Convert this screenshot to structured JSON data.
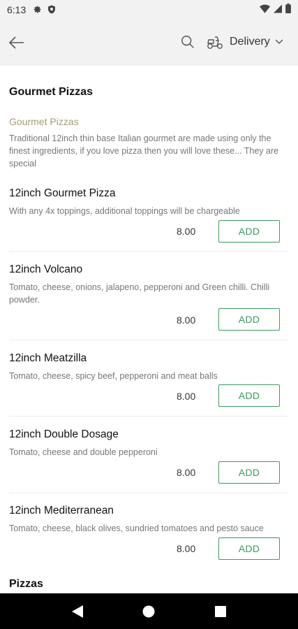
{
  "status_bar": {
    "time": "6:13",
    "icons": [
      "gear-icon",
      "shield-icon",
      "wifi-icon",
      "signal-icon",
      "battery-icon"
    ]
  },
  "header": {
    "back_icon": "arrow-left-icon",
    "search_icon": "search-icon",
    "delivery_icon": "scooter-icon",
    "delivery_label": "Delivery",
    "dropdown_icon": "chevron-down-icon"
  },
  "section": {
    "title": "Gourmet Pizzas",
    "sub_heading": "Gourmet Pizzas",
    "description": "Traditional 12inch thin base Italian gourmet are made using only the finest ingredients, if you love pizza then you will love these... They are special"
  },
  "items": [
    {
      "name": "12inch Gourmet Pizza",
      "description": "With any 4x toppings, additional toppings will be chargeable",
      "price": "8.00",
      "button": "ADD"
    },
    {
      "name": "12inch Volcano",
      "description": "Tomato, cheese, onions, jalapeno, pepperoni and Green chilli. Chilli powder.",
      "price": "8.00",
      "button": "ADD"
    },
    {
      "name": "12inch Meatzilla",
      "description": "Tomato, cheese, spicy beef, pepperoni and meat balls",
      "price": "8.00",
      "button": "ADD"
    },
    {
      "name": "12inch Double Dosage",
      "description": "Tomato, cheese and double pepperoni",
      "price": "8.00",
      "button": "ADD"
    },
    {
      "name": "12inch Mediterranean",
      "description": "Tomato, cheese, black olives, sundried tomatoes and pesto sauce",
      "price": "8.00",
      "button": "ADD"
    }
  ],
  "next_section": {
    "title": "Pizzas"
  },
  "nav_bar": {
    "icons": [
      "back-triangle-icon",
      "home-circle-icon",
      "recents-square-icon"
    ]
  },
  "colors": {
    "accent_green": "#3a9b5c",
    "subheading_gold": "#a89b73",
    "header_bg": "#f2f2f2"
  }
}
